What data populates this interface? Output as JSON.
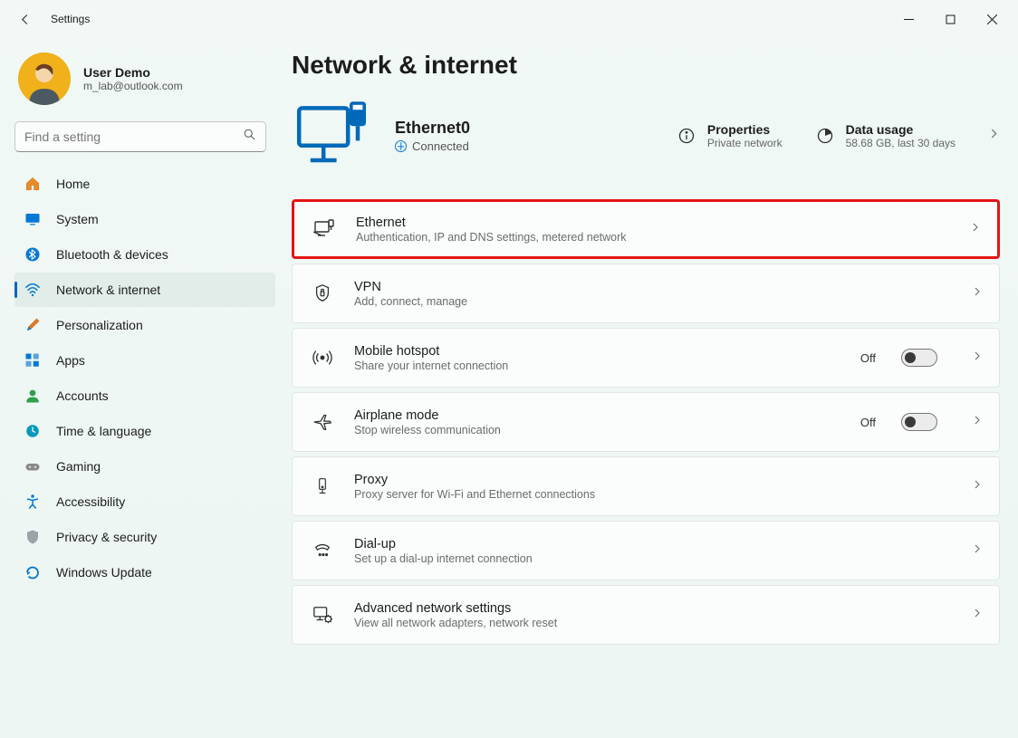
{
  "window": {
    "title": "Settings"
  },
  "user": {
    "name": "User Demo",
    "email": "m_lab@outlook.com"
  },
  "search": {
    "placeholder": "Find a setting"
  },
  "nav": {
    "items": [
      {
        "label": "Home"
      },
      {
        "label": "System"
      },
      {
        "label": "Bluetooth & devices"
      },
      {
        "label": "Network & internet"
      },
      {
        "label": "Personalization"
      },
      {
        "label": "Apps"
      },
      {
        "label": "Accounts"
      },
      {
        "label": "Time & language"
      },
      {
        "label": "Gaming"
      },
      {
        "label": "Accessibility"
      },
      {
        "label": "Privacy & security"
      },
      {
        "label": "Windows Update"
      }
    ]
  },
  "page": {
    "title": "Network & internet",
    "connection": {
      "name": "Ethernet0",
      "status": "Connected"
    },
    "properties": {
      "label": "Properties",
      "desc": "Private network"
    },
    "usage": {
      "label": "Data usage",
      "desc": "58.68 GB, last 30 days"
    }
  },
  "cards": {
    "ethernet": {
      "title": "Ethernet",
      "desc": "Authentication, IP and DNS settings, metered network"
    },
    "vpn": {
      "title": "VPN",
      "desc": "Add, connect, manage"
    },
    "hotspot": {
      "title": "Mobile hotspot",
      "desc": "Share your internet connection",
      "toggle": "Off"
    },
    "airplane": {
      "title": "Airplane mode",
      "desc": "Stop wireless communication",
      "toggle": "Off"
    },
    "proxy": {
      "title": "Proxy",
      "desc": "Proxy server for Wi-Fi and Ethernet connections"
    },
    "dialup": {
      "title": "Dial-up",
      "desc": "Set up a dial-up internet connection"
    },
    "advanced": {
      "title": "Advanced network settings",
      "desc": "View all network adapters, network reset"
    }
  }
}
